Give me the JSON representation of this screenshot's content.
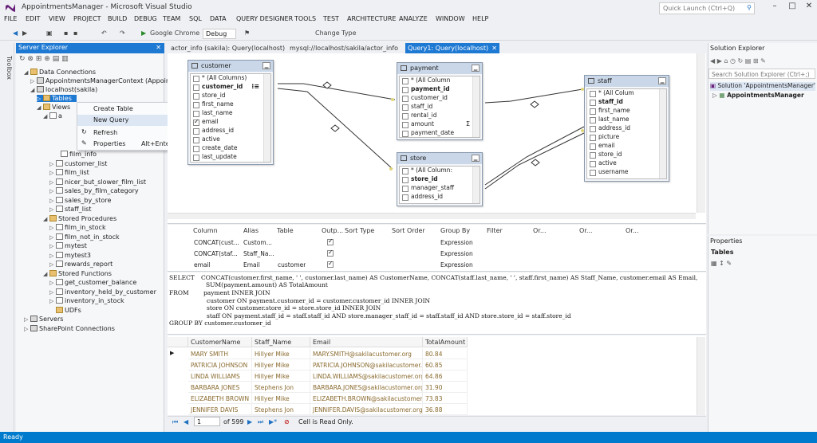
{
  "window": {
    "title": "AppointmentsManager - Microsoft Visual Studio",
    "quick_launch_placeholder": "Quick Launch (Ctrl+Q)"
  },
  "menu": [
    "FILE",
    "EDIT",
    "VIEW",
    "PROJECT",
    "BUILD",
    "DEBUG",
    "TEAM",
    "SQL",
    "DATA",
    "QUERY DESIGNER",
    "TOOLS",
    "TEST",
    "ARCHITECTURE",
    "ANALYZE",
    "WINDOW",
    "HELP"
  ],
  "toolbar": {
    "browser": "Google Chrome",
    "config": "Debug",
    "change_type": "Change Type"
  },
  "toolbox_label": "Toolbox",
  "server_explorer": {
    "title": "Server Explorer",
    "tree": [
      "Data Connections",
      "AppointmentsManagerContext (Appointm",
      "localhost(sakila)",
      "Tables",
      "Views",
      "a",
      "film_info",
      "customer_list",
      "film_list",
      "nicer_but_slower_film_list",
      "sales_by_film_category",
      "sales_by_store",
      "staff_list",
      "Stored Procedures",
      "film_in_stock",
      "film_not_in_stock",
      "mytest",
      "mytest3",
      "rewards_report",
      "Stored Functions",
      "get_customer_balance",
      "inventory_held_by_customer",
      "inventory_in_stock",
      "UDFs",
      "Servers",
      "SharePoint Connections"
    ]
  },
  "context_menu": {
    "items": [
      "Create Table",
      "New Query",
      "Refresh",
      "Properties"
    ],
    "shortcut": "Alt+Enter"
  },
  "tabs": [
    "actor_info (sakila): Query(localhost)",
    "mysql://localhost/sakila/actor_info",
    "Query1: Query(localhost)"
  ],
  "diagram": {
    "customer": {
      "title": "customer",
      "cols": [
        "* (All Columns)",
        "customer_id",
        "store_id",
        "first_name",
        "last_name",
        "email",
        "address_id",
        "active",
        "create_date",
        "last_update"
      ]
    },
    "payment": {
      "title": "payment",
      "cols": [
        "* (All Column",
        "payment_id",
        "customer_id",
        "staff_id",
        "rental_id",
        "amount",
        "payment_date"
      ]
    },
    "store": {
      "title": "store",
      "cols": [
        "* (All Column:",
        "store_id",
        "manager_staff",
        "address_id"
      ]
    },
    "staff": {
      "title": "staff",
      "cols": [
        "* (All Colum",
        "staff_id",
        "first_name",
        "last_name",
        "address_id",
        "picture",
        "email",
        "store_id",
        "active",
        "username"
      ]
    },
    "group_icon": "⁝≡",
    "sum_icon": "Σ"
  },
  "grid": {
    "headers": [
      "Column",
      "Alias",
      "Table",
      "Outp...",
      "Sort Type",
      "Sort Order",
      "Group By",
      "Filter",
      "Or...",
      "Or...",
      "Or..."
    ],
    "rows": [
      [
        "CONCAT(cust...",
        "Custom...",
        "",
        "Expression"
      ],
      [
        "CONCAT(staf...",
        "Staff_Na...",
        "",
        "Expression"
      ],
      [
        "email",
        "Email",
        "customer",
        "Expression"
      ]
    ]
  },
  "sql": {
    "l1k": "SELECT",
    "l1": "CONCAT(customer.first_name, ' ', customer.last_name) AS CustomerName, CONCAT(staff.last_name, ' ', staff.first_name) AS Staff_Name, customer.email AS Email,",
    "l2": "SUM(payment.amount) AS TotalAmount",
    "l3k": "FROM",
    "l3": "payment INNER JOIN",
    "l4": "customer ON payment.customer_id = customer.customer_id INNER JOIN",
    "l5": "store ON customer.store_id = store.store_id INNER JOIN",
    "l6": "staff ON payment.staff_id = staff.staff_id AND store.manager_staff_id = staff.staff_id AND store.store_id = staff.store_id",
    "l7": "GROUP BY customer.customer_id"
  },
  "results": {
    "headers": [
      "CustomerName",
      "Staff_Name",
      "Email",
      "TotalAmount"
    ],
    "rows": [
      [
        "MARY SMITH",
        "Hillyer Mike",
        "MARY.SMITH@sakilacustomer.org",
        "80.84"
      ],
      [
        "PATRICIA JOHNSON",
        "Hillyer Mike",
        "PATRICIA.JOHNSON@sakilacustomer.org",
        "60.85"
      ],
      [
        "LINDA WILLIAMS",
        "Hillyer Mike",
        "LINDA.WILLIAMS@sakilacustomer.org",
        "64.86"
      ],
      [
        "BARBARA JONES",
        "Stephens Jon",
        "BARBARA.JONES@sakilacustomer.org",
        "31.90"
      ],
      [
        "ELIZABETH BROWN",
        "Hillyer Mike",
        "ELIZABETH.BROWN@sakilacustomer....",
        "73.83"
      ],
      [
        "JENNIFER DAVIS",
        "Stephens Jon",
        "JENNIFER.DAVIS@sakilacustomer.org",
        "36.88"
      ]
    ],
    "nav": {
      "current": "1",
      "total": "of 599",
      "status": "Cell is Read Only."
    }
  },
  "solution_explorer": {
    "title": "Solution Explorer",
    "search": "Search Solution Explorer (Ctrl+;)",
    "items": [
      "Solution 'AppointmentsManager'",
      "AppointmentsManager"
    ]
  },
  "properties": {
    "title": "Properties",
    "item": "Tables"
  },
  "status": "Ready"
}
